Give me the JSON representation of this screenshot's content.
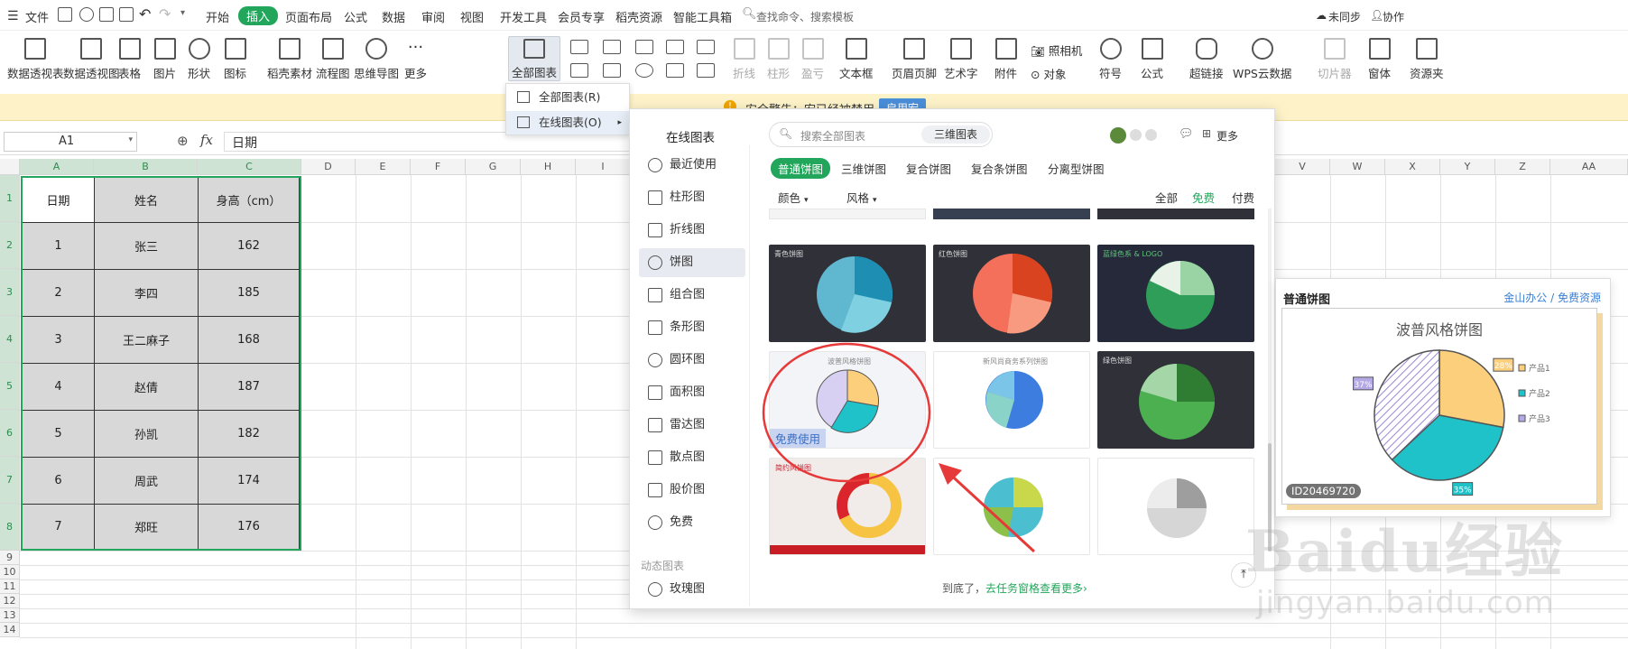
{
  "menu": {
    "file": "文件",
    "tabs": [
      "开始",
      "插入",
      "页面布局",
      "公式",
      "数据",
      "审阅",
      "视图",
      "开发工具",
      "会员专享",
      "稻壳资源",
      "智能工具箱"
    ],
    "active_tab": "插入",
    "search": "查找命令、搜索模板",
    "sync": "未同步",
    "collab": "协作"
  },
  "ribbon": {
    "buttons": [
      "数据透视表",
      "数据透视图",
      "表格",
      "图片",
      "形状",
      "图标",
      "稻壳素材",
      "流程图",
      "思维导图",
      "更多",
      "全部图表"
    ],
    "sparklines": [
      "折线",
      "柱形",
      "盈亏"
    ],
    "right": [
      "文本框",
      "页眉页脚",
      "艺术字",
      "附件",
      "照相机",
      "对象",
      "符号",
      "公式",
      "超链接",
      "WPS云数据",
      "切片器",
      "窗体",
      "资源夹"
    ]
  },
  "dropdown": {
    "items": [
      "全部图表(R)",
      "在线图表(O)"
    ]
  },
  "security": {
    "text": "安全警告：宏已经被禁用",
    "button": "启用宏"
  },
  "formula": {
    "namebox": "A1",
    "fx": "fx",
    "value": "日期"
  },
  "sheet": {
    "columns": [
      "A",
      "B",
      "C",
      "D",
      "E",
      "F",
      "G",
      "H",
      "I",
      "V",
      "W",
      "X",
      "Y",
      "Z",
      "AA"
    ],
    "rows": [
      "1",
      "2",
      "3",
      "4",
      "5",
      "6",
      "7",
      "8",
      "9",
      "10",
      "11",
      "12",
      "13",
      "14"
    ],
    "table": {
      "headers": [
        "日期",
        "姓名",
        "身高（cm）"
      ],
      "rows": [
        [
          "1",
          "张三",
          "162"
        ],
        [
          "2",
          "李四",
          "185"
        ],
        [
          "3",
          "王二麻子",
          "168"
        ],
        [
          "4",
          "赵倩",
          "187"
        ],
        [
          "5",
          "孙凯",
          "182"
        ],
        [
          "6",
          "周武",
          "174"
        ],
        [
          "7",
          "郑旺",
          "176"
        ]
      ]
    }
  },
  "panel": {
    "title": "在线图表",
    "search_placeholder": "搜索全部图表",
    "search_tab": "三维图表",
    "more": "更多",
    "sidebar": [
      "最近使用",
      "柱形图",
      "折线图",
      "饼图",
      "组合图",
      "条形图",
      "圆环图",
      "面积图",
      "雷达图",
      "散点图",
      "股价图",
      "免费"
    ],
    "sidebar_active": "饼图",
    "dynamic_section": "动态图表",
    "dynamic_items": [
      "玫瑰图"
    ],
    "chart_tabs": [
      "普通饼图",
      "三维饼图",
      "复合饼图",
      "复合条饼图",
      "分离型饼图"
    ],
    "filters": {
      "color": "颜色",
      "style": "风格"
    },
    "price_filters": [
      "全部",
      "免费",
      "付费"
    ],
    "thumbs": [
      "青色饼图",
      "红色饼图",
      "蓝绿色系 & LOGO",
      "波普风格饼图",
      "新风尚商务系列饼图",
      "绿色饼图",
      "简约风饼图",
      "",
      "",
      ""
    ],
    "free_label": "免费使用",
    "footer_prefix": "到底了，",
    "footer_link": "去任务窗格查看更多",
    "footer_suffix": "›"
  },
  "preview": {
    "header": "普通饼图",
    "source_a": "金山办公",
    "source_sep": "/",
    "source_b": "免费资源",
    "chart_title": "波普风格饼图",
    "id": "ID20469720",
    "legend": [
      "产品1",
      "产品2",
      "产品3"
    ]
  },
  "chart_data": {
    "type": "pie",
    "title": "波普风格饼图",
    "categories": [
      "产品1",
      "产品2",
      "产品3"
    ],
    "values": [
      28,
      35,
      37
    ],
    "labels": [
      "28%",
      "35%",
      "37%"
    ],
    "colors": [
      "#fbcf7c",
      "#1fc2c8",
      "#b5a8e6"
    ]
  },
  "watermark": {
    "main": "Baidu经验",
    "sub": "jingyan.baidu.com"
  }
}
